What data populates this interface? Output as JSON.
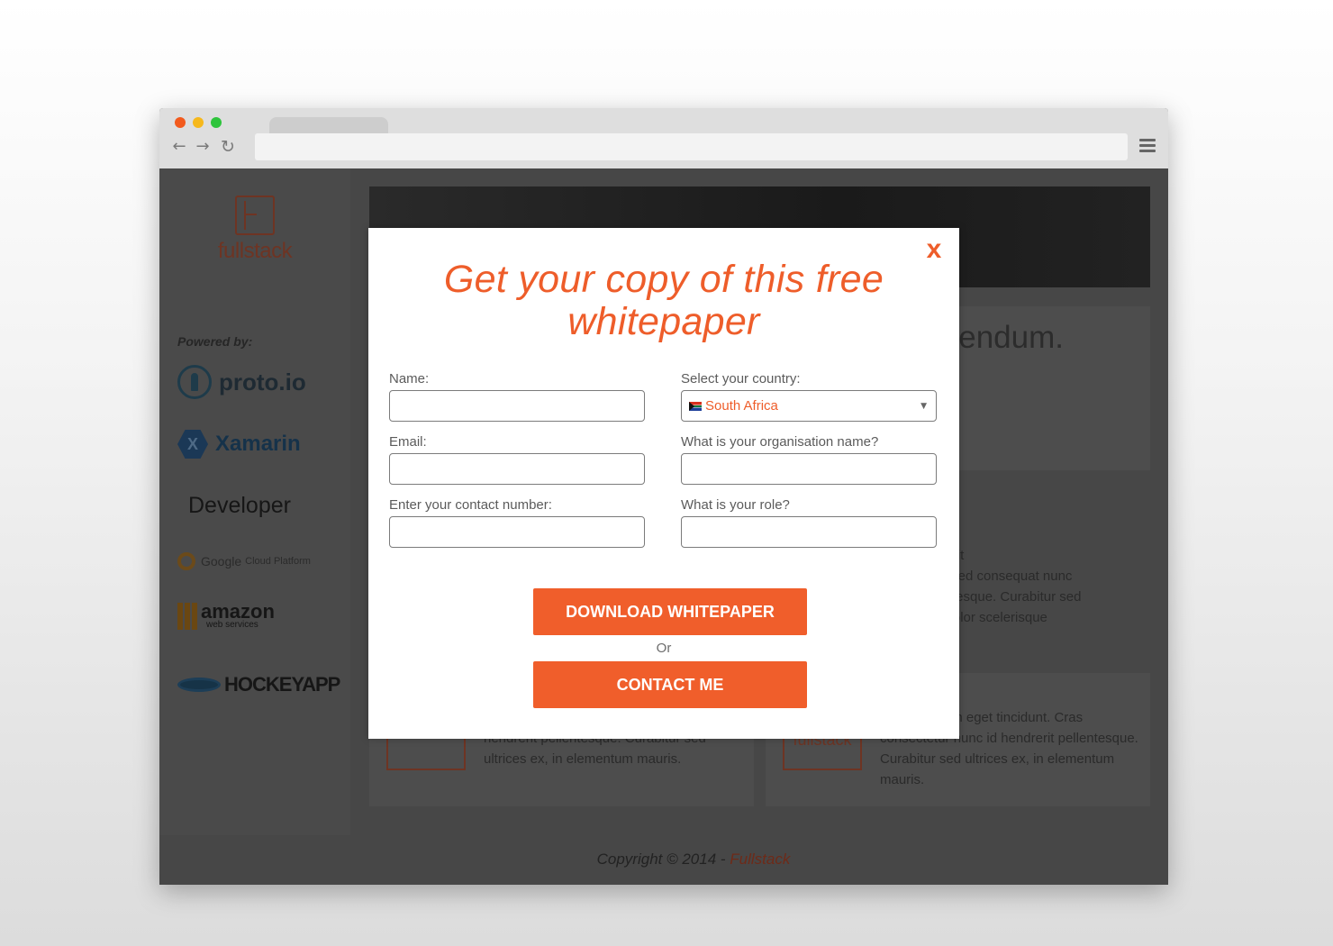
{
  "sidebar": {
    "logo_text": "fullstack",
    "powered_by": "Powered by:",
    "sponsors": {
      "proto": "proto.io",
      "xamarin": "Xamarin",
      "xamarin_mark": "X",
      "apple": "Developer",
      "google": "Google",
      "google_sub": "Cloud Platform",
      "amazon": "amazon",
      "amazon_sub": "web services",
      "hockey": "HOCKEYAPP"
    }
  },
  "background": {
    "heading_fragment": "ibendum.",
    "paragraph_fragment": "ollicit\nlit, sed consequat nunc\nlentesque. Curabitur sed\nd dolor scelerisque",
    "card1": {
      "text": "tincidunt. Cras consectetur nunc id hendrerit pellentesque. Curabitur sed ultrices ex, in elementum mauris."
    },
    "card2": {
      "title_fragment": "ack",
      "thumb_logo": "fullstack",
      "text": "aretra id enim eget tincidunt. Cras consectetur nunc id hendrerit pellentesque. Curabitur sed ultrices ex, in elementum mauris."
    },
    "copyright": "Copyright © 2014 - ",
    "copyright_brand": "Fullstack"
  },
  "modal": {
    "close": "x",
    "title": "Get your copy of this free whitepaper",
    "fields": {
      "name_label": "Name:",
      "email_label": "Email:",
      "contact_label": "Enter your contact number:",
      "country_label": "Select your country:",
      "country_value": "South Africa",
      "org_label": "What is your organisation name?",
      "role_label": "What is your role?"
    },
    "download_button": "DOWNLOAD WHITEPAPER",
    "or": "Or",
    "contact_button": "CONTACT ME"
  },
  "colors": {
    "accent": "#f05e2b",
    "title": "#ee5d2a",
    "overlay": "#474747"
  }
}
